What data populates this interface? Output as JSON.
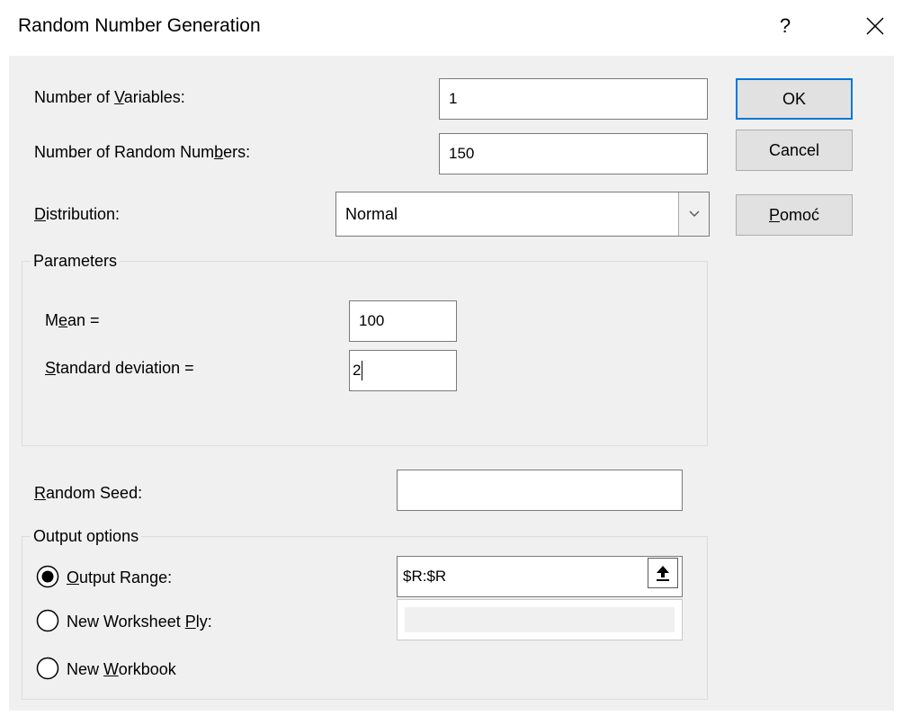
{
  "window": {
    "title": "Random Number Generation",
    "help_label": "?",
    "close_icon": "close-icon"
  },
  "fields": {
    "num_variables": {
      "label_pre": "Number of ",
      "label_mn": "V",
      "label_post": "ariables:",
      "value": "1"
    },
    "num_random": {
      "label_pre": "Number of Random Num",
      "label_mn": "b",
      "label_post": "ers:",
      "value": "150"
    },
    "distribution": {
      "label_pre": "",
      "label_mn": "D",
      "label_post": "istribution:",
      "value": "Normal"
    }
  },
  "parameters": {
    "group_label": "Parameters",
    "mean": {
      "label_pre": "M",
      "label_mn": "e",
      "label_post": "an =",
      "value": "100"
    },
    "stddev": {
      "label_pre": "",
      "label_mn": "S",
      "label_post": "tandard deviation =",
      "value": "2"
    }
  },
  "seed": {
    "label_pre": "",
    "label_mn": "R",
    "label_post": "andom Seed:",
    "value": ""
  },
  "output": {
    "group_label": "Output options",
    "range": {
      "label_pre": "",
      "label_mn": "O",
      "label_post": "utput Range:",
      "value": "$R:$R",
      "selected": true
    },
    "worksheet": {
      "label_pre": "New Worksheet ",
      "label_mn": "P",
      "label_post": "ly:",
      "selected": false
    },
    "workbook": {
      "label_pre": "New ",
      "label_mn": "W",
      "label_post": "orkbook",
      "selected": false
    }
  },
  "buttons": {
    "ok": "OK",
    "cancel": "Cancel",
    "help_pre": "",
    "help_mn": "P",
    "help_post": "omoć"
  },
  "colors": {
    "accent": "#0078d7",
    "client_bg": "#f0f0f0",
    "button_bg": "#e1e1e1"
  }
}
